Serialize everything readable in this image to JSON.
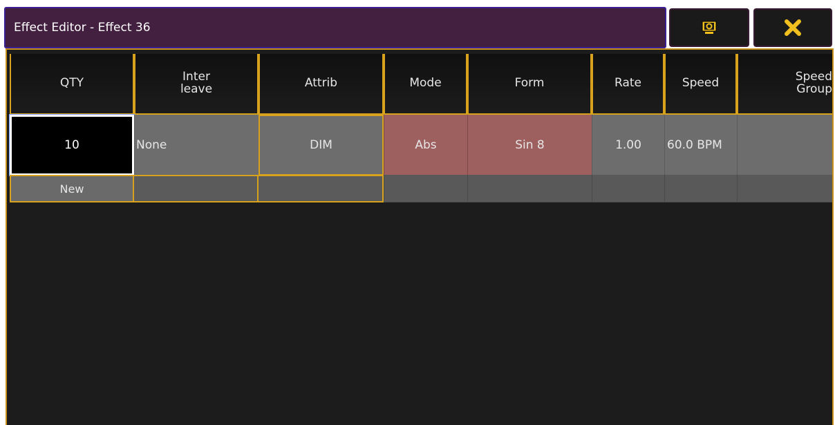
{
  "window": {
    "title": "Effect Editor - Effect 36",
    "view_icon": "view-screen-icon",
    "close_icon": "close-x-icon"
  },
  "columns": {
    "qty": "QTY",
    "interleave_1": "Inter",
    "interleave_2": "leave",
    "attrib": "Attrib",
    "mode": "Mode",
    "form": "Form",
    "rate": "Rate",
    "speed": "Speed",
    "speed_group_1": "Speed",
    "speed_group_2": "Group"
  },
  "row": {
    "qty": "10",
    "interleave": "None",
    "attrib": "DIM",
    "mode": "Abs",
    "form": "Sin 8",
    "rate": "1.00",
    "speed": "60.0 BPM",
    "speed_group": ""
  },
  "new_row": {
    "label": "New"
  },
  "colors": {
    "title_bg": "#43203f",
    "accent_gold": "#d9a21c",
    "cell_gray": "#6d6d6d",
    "cell_red": "#9e5f5f",
    "close_yellow": "#f2c01e"
  }
}
